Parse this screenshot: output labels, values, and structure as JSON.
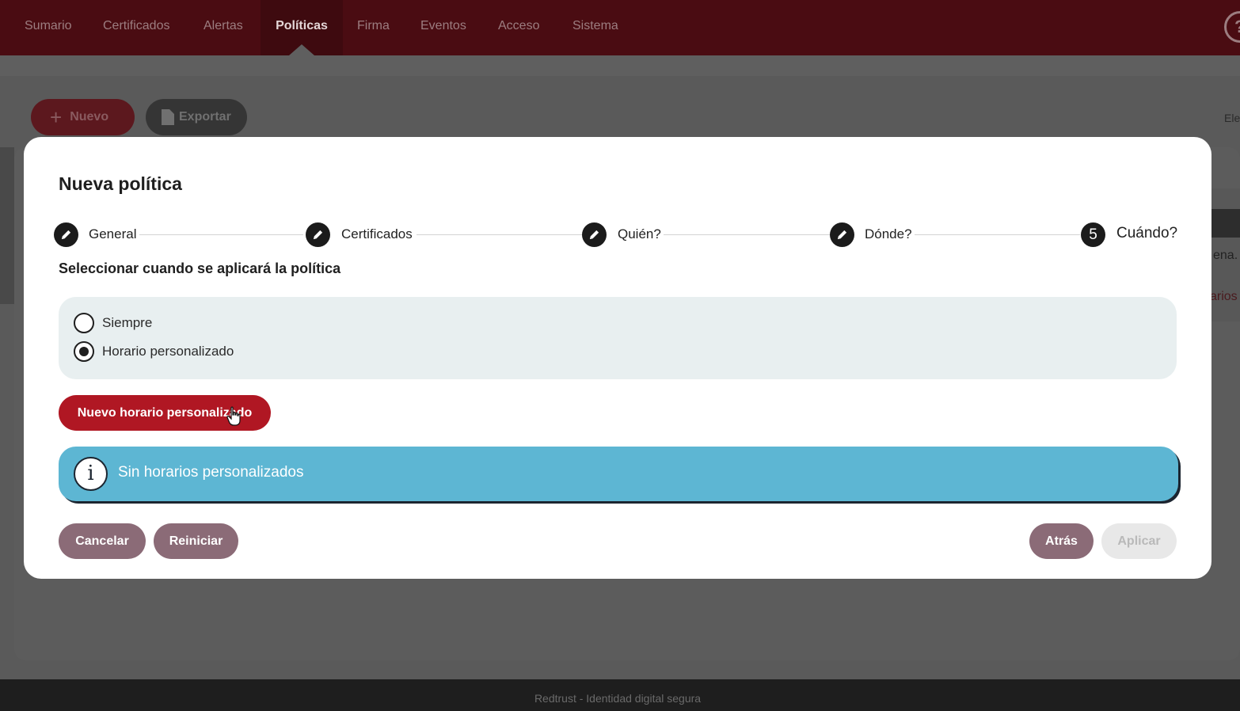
{
  "nav": {
    "items": [
      "Sumario",
      "Certificados",
      "Alertas",
      "Políticas",
      "Firma",
      "Eventos",
      "Acceso",
      "Sistema"
    ],
    "active": "Políticas",
    "help_icon": "help-icon"
  },
  "toolbar": {
    "new_label": "Nuevo",
    "export_label": "Exportar",
    "side_text": "Ele"
  },
  "background": {
    "right_text_1": "ena.",
    "right_text_2": "arios"
  },
  "modal": {
    "title": "Nueva política",
    "steps": [
      {
        "label": "General",
        "state": "done",
        "icon": "pencil-icon"
      },
      {
        "label": "Certificados",
        "state": "done",
        "icon": "pencil-icon"
      },
      {
        "label": "Quién?",
        "state": "done",
        "icon": "pencil-icon"
      },
      {
        "label": "Dónde?",
        "state": "done",
        "icon": "pencil-icon"
      },
      {
        "label": "Cuándo?",
        "state": "current",
        "number": "5"
      }
    ],
    "section_title": "Seleccionar cuando se aplicará la política",
    "options": [
      {
        "label": "Siempre",
        "selected": false
      },
      {
        "label": "Horario personalizado",
        "selected": true
      }
    ],
    "new_schedule_label": "Nuevo horario personalizado",
    "info_message": "Sin horarios personalizados",
    "buttons": {
      "cancel": "Cancelar",
      "reset": "Reiniciar",
      "back": "Atrás",
      "apply": "Aplicar"
    }
  },
  "footer": {
    "text": "Redtrust - Identidad digital segura"
  },
  "colors": {
    "nav_bg": "#4a0c12",
    "primary_red": "#b01723",
    "muted_button": "#8b6b77",
    "info_blue": "#5db6d3",
    "radio_panel": "#e8eff0"
  }
}
